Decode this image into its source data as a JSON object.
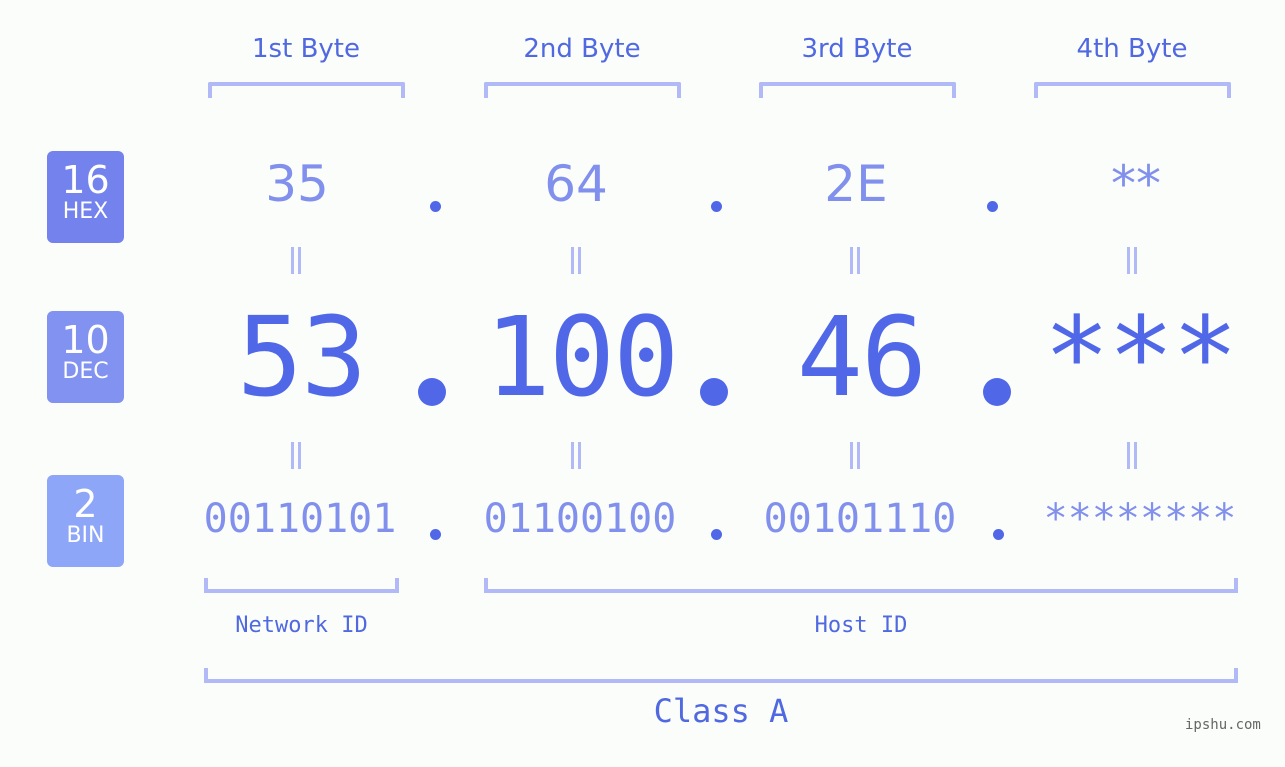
{
  "headers": [
    "1st Byte",
    "2nd Byte",
    "3rd Byte",
    "4th Byte"
  ],
  "badges": {
    "hex": {
      "num": "16",
      "label": "HEX",
      "color": "#7382ec"
    },
    "dec": {
      "num": "10",
      "label": "DEC",
      "color": "#8192f0"
    },
    "bin": {
      "num": "2",
      "label": "BIN",
      "color": "#8ea6f8"
    }
  },
  "hex": [
    "35",
    "64",
    "2E",
    "**"
  ],
  "dec": [
    "53",
    "100",
    "46",
    "***"
  ],
  "bin": [
    "00110101",
    "01100100",
    "00101110",
    "********"
  ],
  "labels": {
    "network": "Network ID",
    "host": "Host ID",
    "class": "Class A"
  },
  "watermark": "ipshu.com",
  "colors": {
    "primary": "#5068e8",
    "secondary": "#8190ec",
    "bracket": "#b1baf7",
    "background": "#fbfdfb"
  }
}
